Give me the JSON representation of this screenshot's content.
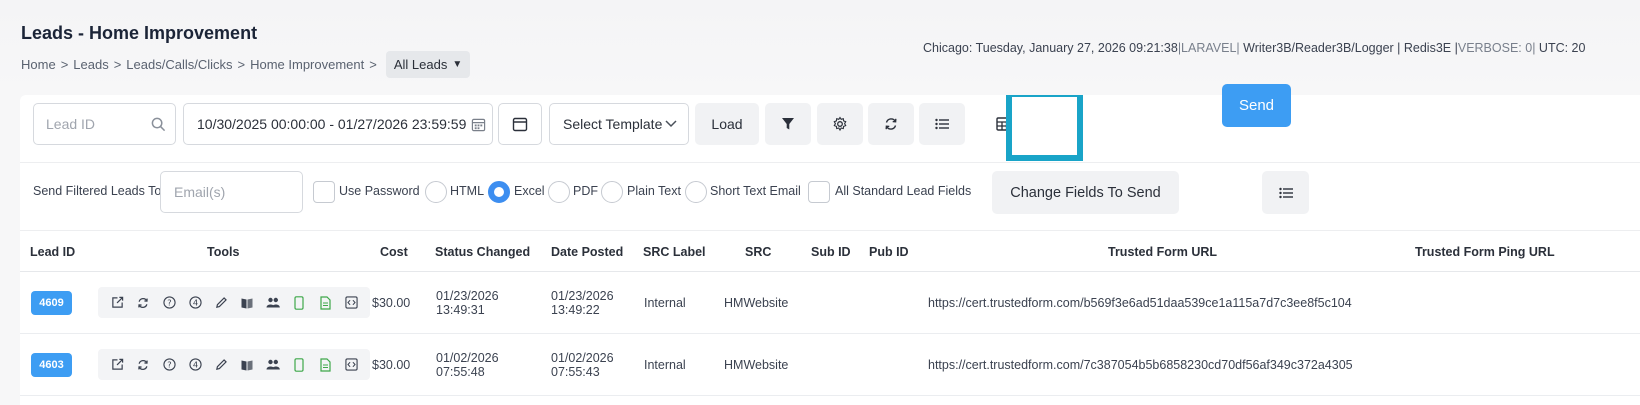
{
  "header": {
    "title": "Leads - Home Improvement",
    "breadcrumb": [
      "Home",
      "Leads",
      "Leads/Calls/Clicks",
      "Home Improvement"
    ],
    "breadcrumb_sep": ">",
    "dropdown_label": "All Leads",
    "sysinfo": {
      "clock": "Chicago: Tuesday, January 27, 2026 09:21:38",
      "framework": "|LARAVEL|",
      "db": " Writer3B/Reader3B/Logger | Redis3E |",
      "verbose": "VERBOSE: 0|",
      "utc": " UTC: 20"
    }
  },
  "toolbar": {
    "lead_id_placeholder": "Lead ID",
    "date_range": "10/30/2025 00:00:00 - 01/27/2026 23:59:59",
    "template_label": "Select Template",
    "load_label": "Load"
  },
  "sendbar": {
    "label": "Send Filtered Leads To",
    "email_placeholder": "Email(s)",
    "use_password": "Use Password",
    "formats": [
      "HTML",
      "Excel",
      "PDF",
      "Plain Text",
      "Short Text Email"
    ],
    "selected_format": "Excel",
    "all_fields": "All Standard Lead Fields",
    "change_fields": "Change Fields To Send",
    "send": "Send"
  },
  "table": {
    "columns": [
      "Lead ID",
      "Tools",
      "Cost",
      "Status Changed",
      "Date Posted",
      "SRC Label",
      "SRC",
      "Sub ID",
      "Pub ID",
      "Trusted Form URL",
      "Trusted Form Ping URL"
    ],
    "rows": [
      {
        "lead_id": "4609",
        "cost": "$30.00",
        "status_changed": [
          "01/23/2026",
          "13:49:31"
        ],
        "date_posted": [
          "01/23/2026",
          "13:49:22"
        ],
        "src_label": "Internal",
        "src": "HMWebsite",
        "sub_id": "",
        "pub_id": "",
        "trusted_form_url": "https://cert.trustedform.com/b569f3e6ad51daa539ce1a115a7d7c3ee8f5c104"
      },
      {
        "lead_id": "4603",
        "cost": "$30.00",
        "status_changed": [
          "01/02/2026",
          "07:55:48"
        ],
        "date_posted": [
          "01/02/2026",
          "07:55:43"
        ],
        "src_label": "Internal",
        "src": "HMWebsite",
        "sub_id": "",
        "pub_id": "",
        "trusted_form_url": "https://cert.trustedform.com/7c387054b5b6858230cd70df56af349c372a4305"
      }
    ],
    "tool_icons": [
      "external-link-icon",
      "refresh-icon",
      "help-circle-icon",
      "number-four-icon",
      "pencil-icon",
      "book-icon",
      "users-icon",
      "phone-icon",
      "document-icon",
      "code-icon"
    ]
  },
  "colors": {
    "accent": "#3d9df3",
    "highlight": "#19a4c8",
    "title": "#1b2437"
  }
}
